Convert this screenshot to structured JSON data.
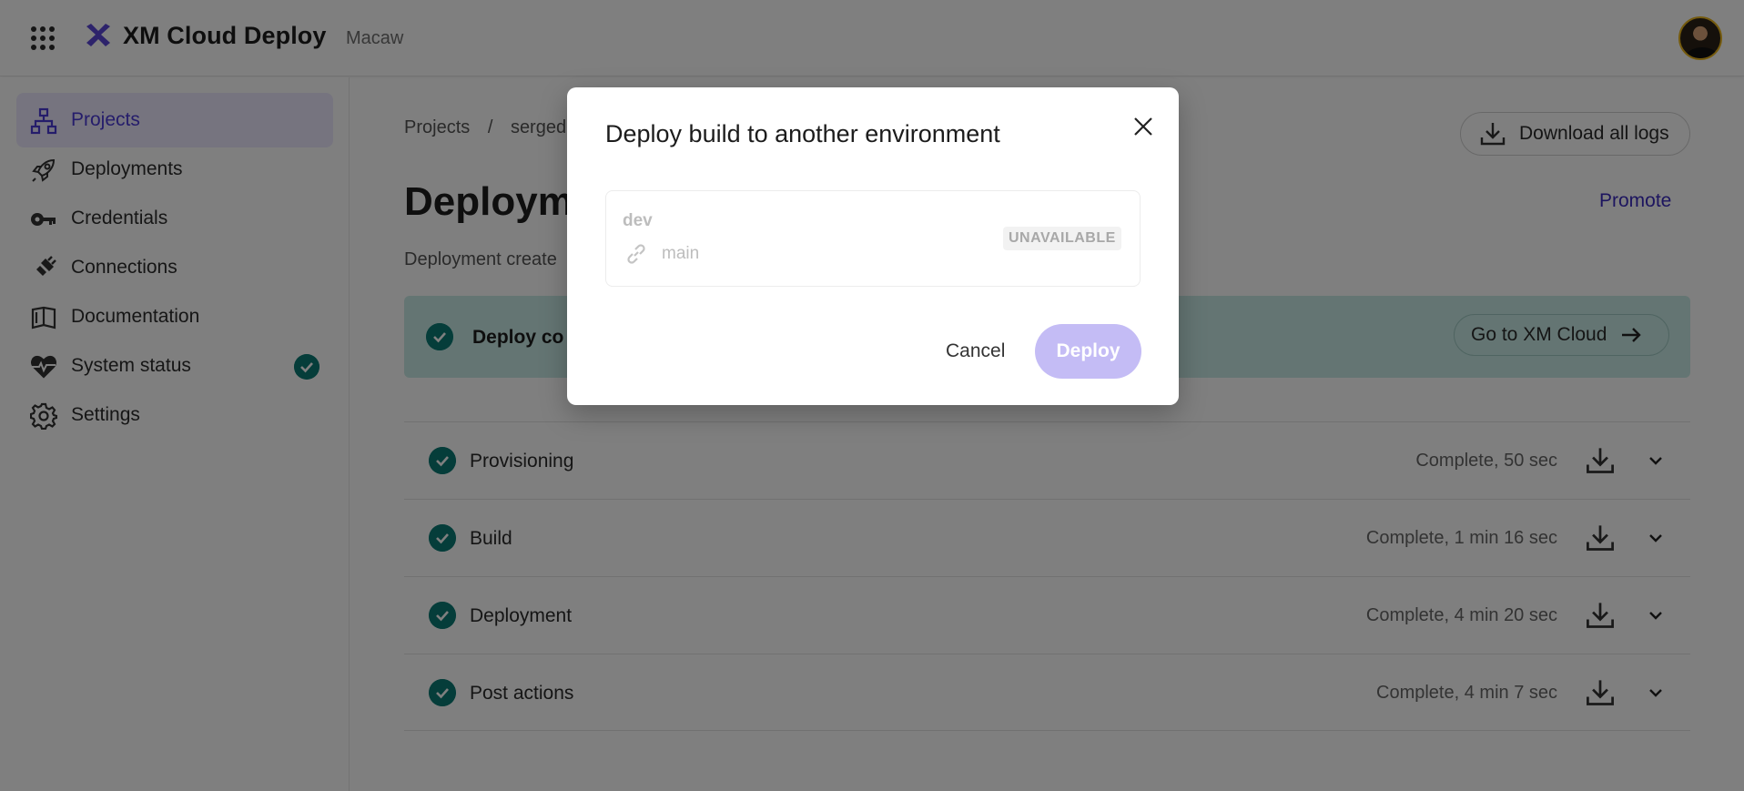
{
  "header": {
    "app_title": "XM Cloud Deploy",
    "org_name": "Macaw"
  },
  "sidebar": {
    "items": [
      {
        "label": "Projects",
        "icon": "sitemap-icon",
        "active": true
      },
      {
        "label": "Deployments",
        "icon": "rocket-icon"
      },
      {
        "label": "Credentials",
        "icon": "key-icon"
      },
      {
        "label": "Connections",
        "icon": "plug-icon"
      },
      {
        "label": "Documentation",
        "icon": "book-icon"
      },
      {
        "label": "System status",
        "icon": "heartbeat-icon",
        "status": "check-icon"
      },
      {
        "label": "Settings",
        "icon": "gear-icon"
      }
    ]
  },
  "main": {
    "breadcrumb": [
      "Projects",
      "/",
      "sergede"
    ],
    "download_logs_label": "Download all logs",
    "page_title": "Deployme",
    "promote_label": "Promote",
    "created_text": "Deployment create",
    "banner_text": "Deploy co",
    "go_to_xm_label": "Go to XM Cloud",
    "steps": [
      {
        "name": "Provisioning",
        "status": "Complete, 50 sec"
      },
      {
        "name": "Build",
        "status": "Complete, 1 min 16 sec"
      },
      {
        "name": "Deployment",
        "status": "Complete, 4 min 20 sec"
      },
      {
        "name": "Post actions",
        "status": "Complete, 4 min 7 sec"
      }
    ]
  },
  "modal": {
    "title": "Deploy build to another environment",
    "environment": {
      "name": "dev",
      "branch": "main",
      "badge": "UNAVAILABLE"
    },
    "cancel_label": "Cancel",
    "deploy_label": "Deploy"
  },
  "colors": {
    "accent": "#4b3ad6",
    "success": "#0b7b74",
    "banner_bg": "#c8ebe6",
    "deploy_disabled": "#c4bcf5"
  }
}
